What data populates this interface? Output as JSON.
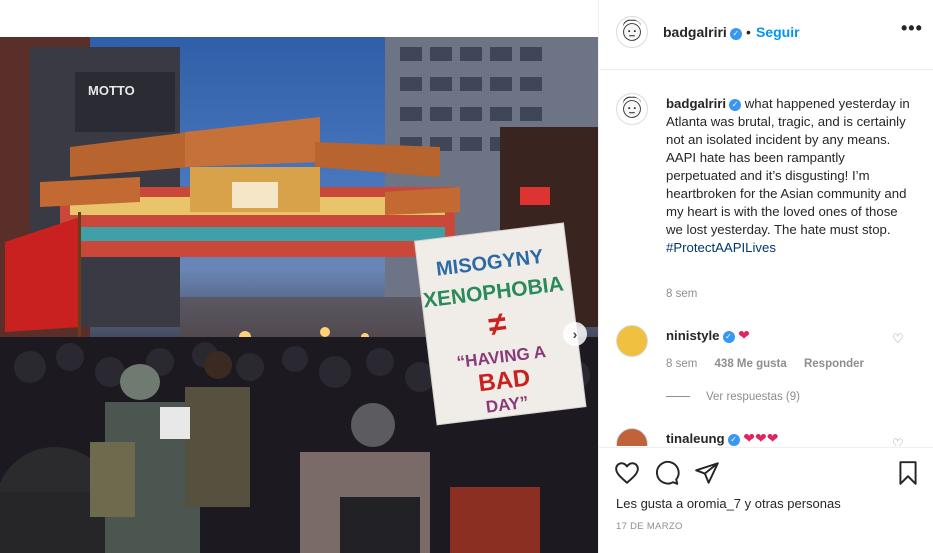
{
  "post": {
    "username": "badgalriri",
    "follow_label": "Seguir",
    "dot": "•",
    "more_icon": "more-horizontal-icon",
    "more_glyph": "•••"
  },
  "photo": {
    "sign_lines": [
      "MISOGYNY",
      "XENOPHOBIA",
      "≠",
      "“HAVING A",
      "BAD",
      "DAY”"
    ],
    "building_sign": "MOTTO",
    "next_glyph": "›"
  },
  "caption": {
    "username": "badgalriri",
    "text": "what happened yesterday in Atlanta was brutal, tragic, and is certainly not an isolated incident by any means. AAPI hate has been rampantly perpetuated and it’s disgusting! I’m heartbroken for the Asian community and my heart is with the loved ones of those we lost yesterday. The hate must stop.",
    "hashtag": "#ProtectAAPILives",
    "time": "8 sem"
  },
  "comments": [
    {
      "username": "ninistyle",
      "text": "❤",
      "time": "8 sem",
      "likes": "438 Me gusta",
      "reply_label": "Responder",
      "view_replies": "Ver respuestas (9)"
    },
    {
      "username": "tinaleung",
      "text": "❤❤❤"
    }
  ],
  "actions": {
    "likes_text": "Les gusta a oromia_7 y otras personas",
    "date": "17 DE MARZO"
  },
  "colors": {
    "accent": "#0095f6",
    "verified": "#3897f0",
    "heart": "#e0245e",
    "muted": "#8e8e8e"
  }
}
